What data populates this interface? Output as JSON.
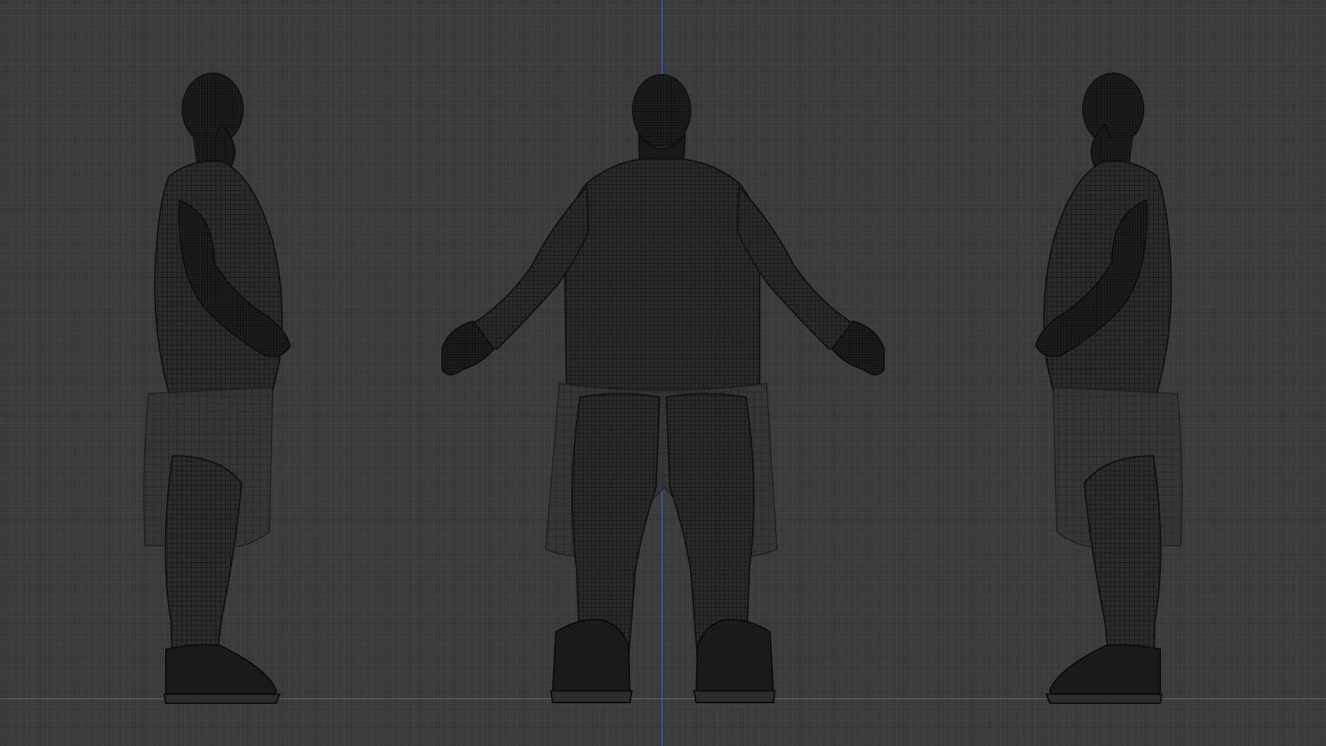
{
  "viewport": {
    "background_color": "#3b3b3b",
    "grid_major_color": "#2c2c2c",
    "axis_x_color": "#b5444c",
    "axis_z_color": "#3a78c8",
    "shading_mode": "wireframe"
  },
  "figures": [
    {
      "view": "side",
      "facing": "right"
    },
    {
      "view": "front",
      "facing": "front"
    },
    {
      "view": "side",
      "facing": "left"
    }
  ]
}
